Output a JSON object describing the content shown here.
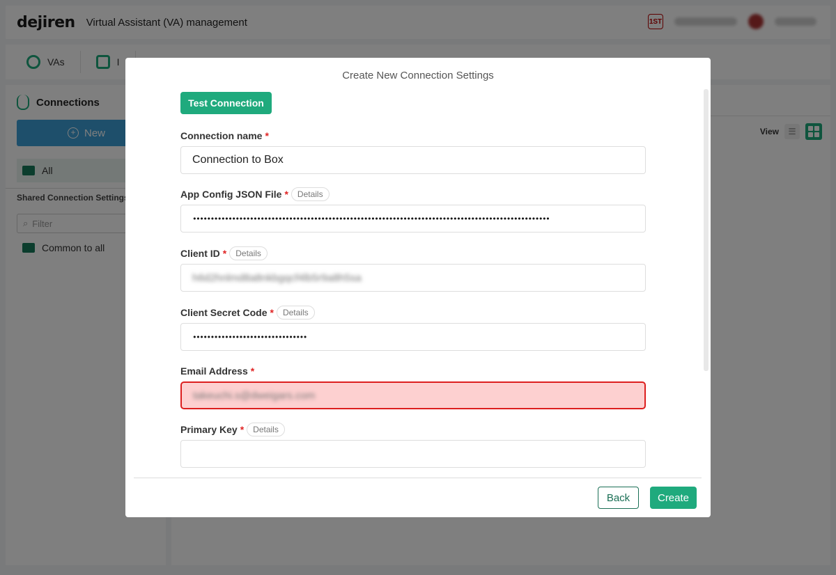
{
  "app": {
    "logo": "dejiren",
    "title": "Virtual Assistant (VA) management",
    "badge": "1ST"
  },
  "tabs": [
    {
      "label": "VAs",
      "icon": "robot-icon"
    },
    {
      "label": "I",
      "icon": "sliders-icon"
    }
  ],
  "sidebar": {
    "heading": "Connections",
    "new_label": "New",
    "all_label": "All",
    "shared_label": "Shared Connection Settings",
    "filter_placeholder": "Filter",
    "common_label": "Common to all"
  },
  "main": {
    "view_label": "View"
  },
  "modal": {
    "title": "Create New Connection Settings",
    "test_button": "Test Connection",
    "fields": {
      "connection_name": {
        "label": "Connection name",
        "required": "*",
        "value": "Connection to Box"
      },
      "app_config": {
        "label": "App Config JSON File",
        "required": "*",
        "details": "Details",
        "value": "••••••••••••••••••••••••••••••••••••••••••••••••••••••••••••••••••••••••••••••••••••••••••••••••••••"
      },
      "client_id": {
        "label": "Client ID",
        "required": "*",
        "details": "Details",
        "value": "h6d2hnlmd8a8nkbgqcf4lb5r9a8h5sa"
      },
      "client_secret": {
        "label": "Client Secret Code",
        "required": "*",
        "details": "Details",
        "value": "••••••••••••••••••••••••••••••••"
      },
      "email": {
        "label": "Email Address",
        "required": "*",
        "value": "takeuchi.s@dweigars.com"
      },
      "primary_key": {
        "label": "Primary Key",
        "required": "*",
        "details": "Details",
        "value": ""
      }
    },
    "back_button": "Back",
    "create_button": "Create"
  },
  "colors": {
    "accent": "#1faa7d",
    "error_bg": "#fdd0d0",
    "error_border": "#dc1e1e",
    "new_button": "#3c9fd6"
  }
}
